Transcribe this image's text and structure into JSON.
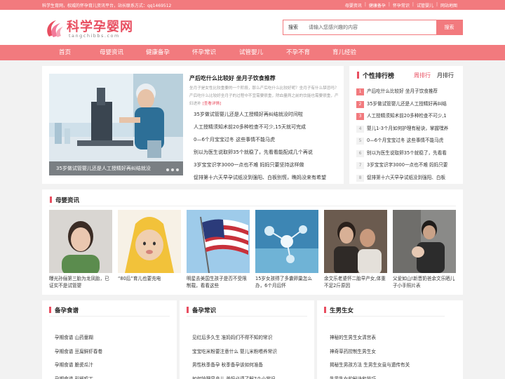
{
  "topbar": {
    "slogan": "科学生育网，权威的怀孕育儿资讯平台，站长联系方式：qq1469512",
    "links": [
      "母婴资讯",
      "健康备孕",
      "怀孕常识",
      "试管婴儿",
      "网站地图"
    ]
  },
  "logo": {
    "cn": "科学孕婴网",
    "en": "tangchibbs.com"
  },
  "search": {
    "label": "搜索",
    "placeholder": "请输入您感兴趣的内容",
    "button": "搜索"
  },
  "nav": [
    "首页",
    "母婴资讯",
    "健康备孕",
    "怀孕常识",
    "试管婴儿",
    "不孕不育",
    "育儿经验"
  ],
  "hot": {
    "caption": "35岁做试管婴儿还是人工授精好再纠结就没",
    "title": "产后吃什么比较好 坐月子饮食推荐",
    "summary": "坐月子是女性比较重要的一个阶段，那么产后吃什么比较好呢？坐月子有什么禁忌吗？产后吃什么比较好坐月子的过程中不宜需要很重，除血量两之前的饮能也需要很重，产妇进补",
    "more": "[查看详情]",
    "list": [
      "35岁做试管婴儿还是人工授精好再纠结就没时间啦",
      "人工授精须知术前20多种检查不可少,15天就可完成",
      "0—6个月宝宝过冬 这些事情不能马虎",
      "别以为医生说取卵35个就稳了，先看看能配成几个再说",
      "3岁宝宝识字3000一点也不难 妈妈只要坚持这样做",
      "促排第十六天早孕试纸没到强阳、白板别慌，瞧妈没来有希望"
    ]
  },
  "rank": {
    "title": "个性排行榜",
    "tabs": [
      "周排行",
      "月排行"
    ],
    "items": [
      {
        "n": "1",
        "t": "产后吃什么比较好 坐月子饮食推荐"
      },
      {
        "n": "2",
        "t": "35岁做试管婴儿还是人工授精好再纠结"
      },
      {
        "n": "3",
        "t": "人工授精须知术前20多种检查不可少,1"
      },
      {
        "n": "4",
        "t": "婴儿1-3个月如何护理有秘诀，掌握嘿养"
      },
      {
        "n": "5",
        "t": "0—6个月宝宝过冬 这些事情不能马虎"
      },
      {
        "n": "6",
        "t": "别以为医生说取卵35个就稳了，先看看"
      },
      {
        "n": "7",
        "t": "3岁宝宝识字3000一点也不难 妈妈只要"
      },
      {
        "n": "8",
        "t": "促排第十六天早孕试纸没到强阳、白板"
      }
    ]
  },
  "baby": {
    "title": "母婴资讯",
    "cards": [
      "曝光孙俪第三胎为龙凤胎，已证实不是试管婴",
      "“80后”育儿也要充电",
      "明星去美国生孩子是否不受限制载，看看这些",
      "15岁女孩得了多囊卵巢怎么办，6个月后怀",
      "余文乐老婆怀二胎早产女,体重不足2斤原因",
      "父爱如山!新晋奶爸余文乐晒儿子小手照片表"
    ]
  },
  "cols": [
    {
      "title": "备孕食谱",
      "items": [
        "孕期食谱 山药童糊",
        "孕期食谱 豆腐鲜虾春卷",
        "孕期食谱 脆瓷瓜汁",
        "孕期食谱 彩椒鸡丁"
      ]
    },
    {
      "title": "备孕常识",
      "items": [
        "见红后多久生 准妈妈们不得不知的常识",
        "宝宝吃米粉要注意什么 婴儿米粉喂养常识",
        "男性秋季备孕 秋季备孕该如何准备",
        "如何护理早产儿 爸妈必须了解7个小常识"
      ]
    },
    {
      "title": "生男生女",
      "items": [
        "神秘的生男生女清宫表",
        "神奇草药控制生男生女",
        "揭秘生男孩方法 生男生女竟与遗传有关",
        "生男生女的秘诀和技巧"
      ]
    }
  ],
  "colors": {
    "accent": "#f27a7e",
    "brand": "#e84e60"
  }
}
